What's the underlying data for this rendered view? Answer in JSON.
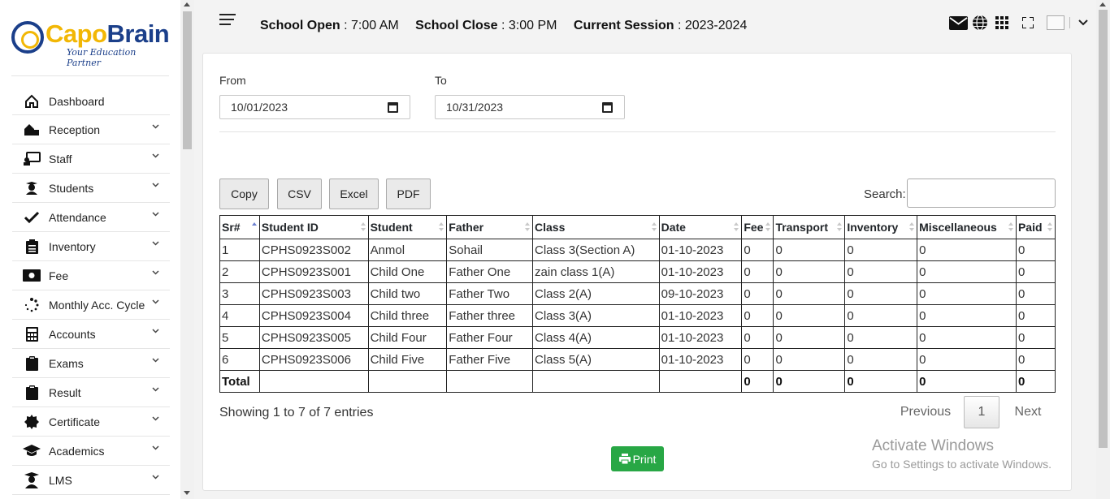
{
  "brand": {
    "name_part1": "Capo",
    "name_part2": "Brain",
    "tagline": "Your Education Partner"
  },
  "sidebar": {
    "items": [
      {
        "label": "Dashboard",
        "icon": "home-icon",
        "has_submenu": false
      },
      {
        "label": "Reception",
        "icon": "reception-icon",
        "has_submenu": true
      },
      {
        "label": "Staff",
        "icon": "staff-icon",
        "has_submenu": true
      },
      {
        "label": "Students",
        "icon": "student-icon",
        "has_submenu": true
      },
      {
        "label": "Attendance",
        "icon": "checkmark-icon",
        "has_submenu": true
      },
      {
        "label": "Inventory",
        "icon": "clipboard-list-icon",
        "has_submenu": true
      },
      {
        "label": "Fee",
        "icon": "money-icon",
        "has_submenu": true
      },
      {
        "label": "Monthly Acc. Cycle",
        "icon": "spinner-icon",
        "has_submenu": true
      },
      {
        "label": "Accounts",
        "icon": "calculator-icon",
        "has_submenu": true
      },
      {
        "label": "Exams",
        "icon": "clipboard-icon",
        "has_submenu": true
      },
      {
        "label": "Result",
        "icon": "clipboard-icon",
        "has_submenu": true
      },
      {
        "label": "Certificate",
        "icon": "certificate-icon",
        "has_submenu": true
      },
      {
        "label": "Academics",
        "icon": "graduation-cap-icon",
        "has_submenu": true
      },
      {
        "label": "LMS",
        "icon": "lms-icon",
        "has_submenu": true
      }
    ]
  },
  "header": {
    "school_open_label": "School Open",
    "school_open_value": " : 7:00 AM",
    "school_close_label": "School Close",
    "school_close_value": " : 3:00 PM",
    "session_label": "Current Session",
    "session_value": " : 2023-2024",
    "icons": [
      "envelope-icon",
      "globe-icon",
      "grid-icon",
      "fullscreen-icon"
    ]
  },
  "filters": {
    "from_label": "From",
    "from_value": "10/01/2023",
    "to_label": "To",
    "to_value": "10/31/2023"
  },
  "export_buttons": {
    "copy": "Copy",
    "csv": "CSV",
    "excel": "Excel",
    "pdf": "PDF"
  },
  "search": {
    "label": "Search:",
    "value": ""
  },
  "table": {
    "columns": [
      "Sr#",
      "Student ID",
      "Student",
      "Father",
      "Class",
      "Date",
      "Fee",
      "Transport",
      "Inventory",
      "Miscellaneous",
      "Paid"
    ],
    "sorted_column": "Sr#",
    "sort_direction": "ascending",
    "rows": [
      [
        "1",
        "CPHS0923S002",
        "Anmol",
        "Sohail",
        "Class 3(Section A)",
        "01-10-2023",
        "0",
        "0",
        "0",
        "0",
        "0"
      ],
      [
        "2",
        "CPHS0923S001",
        "Child One",
        "Father One",
        "zain class 1(A)",
        "01-10-2023",
        "0",
        "0",
        "0",
        "0",
        "0"
      ],
      [
        "3",
        "CPHS0923S003",
        "Child two",
        "Father Two",
        "Class 2(A)",
        "09-10-2023",
        "0",
        "0",
        "0",
        "0",
        "0"
      ],
      [
        "4",
        "CPHS0923S004",
        "Child three",
        "Father three",
        "Class 3(A)",
        "01-10-2023",
        "0",
        "0",
        "0",
        "0",
        "0"
      ],
      [
        "5",
        "CPHS0923S005",
        "Child Four",
        "Father Four",
        "Class 4(A)",
        "01-10-2023",
        "0",
        "0",
        "0",
        "0",
        "0"
      ],
      [
        "6",
        "CPHS0923S006",
        "Child Five",
        "Father Five",
        "Class 5(A)",
        "01-10-2023",
        "0",
        "0",
        "0",
        "0",
        "0"
      ]
    ],
    "total_row": [
      "Total",
      "",
      "",
      "",
      "",
      "",
      "0",
      "0",
      "0",
      "0",
      "0"
    ]
  },
  "pagination": {
    "info": "Showing 1 to 7 of 7 entries",
    "previous": "Previous",
    "current_page": "1",
    "next": "Next"
  },
  "print_button": "Print",
  "colors": {
    "brand_yellow": "#f2b705",
    "brand_blue": "#1b3f8a",
    "print_green": "#28a745"
  },
  "watermark": {
    "line1": "Activate Windows",
    "line2": "Go to Settings to activate Windows."
  }
}
